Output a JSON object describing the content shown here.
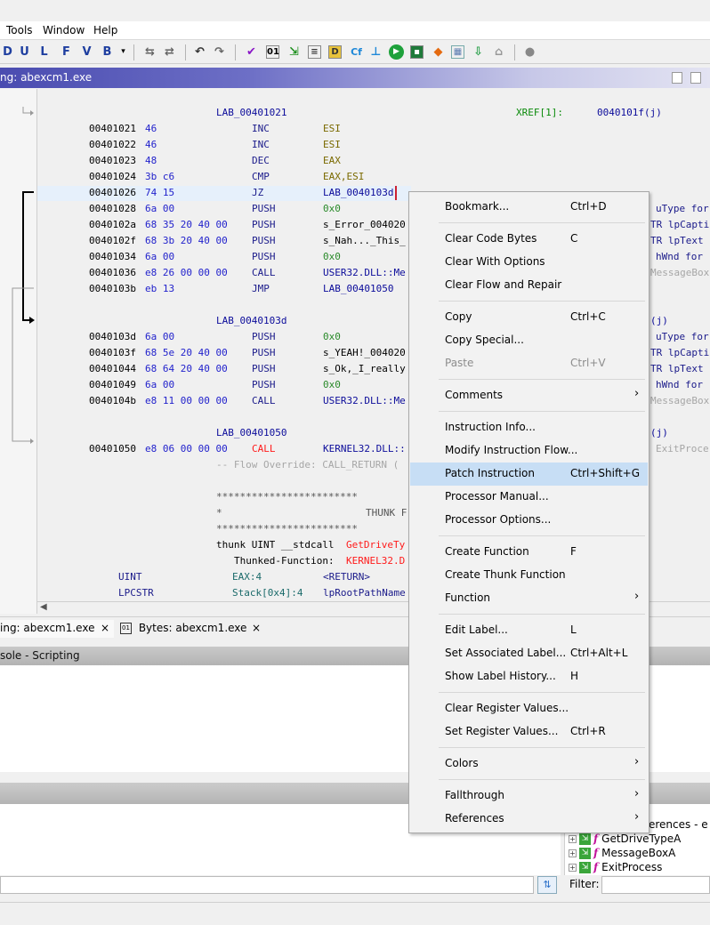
{
  "menubar": {
    "items": [
      "Tools",
      "Window",
      "Help"
    ]
  },
  "toolbar": {
    "letters": [
      "D",
      "U",
      "L",
      "F",
      "V",
      "B"
    ],
    "dropdown": "▾",
    "icons": [
      "undo-icon",
      "redo-icon",
      "checkmark-icon",
      "bytes-icon",
      "function-graph-icon",
      "data-icon",
      "cfg-icon",
      "tree-icon",
      "run-icon",
      "memory-icon",
      "diamond-icon",
      "table-icon",
      "export-icon",
      "network-icon",
      "help-icon"
    ]
  },
  "listing": {
    "title": "ng: abexcm1.exe",
    "lines": [
      {
        "label": "LAB_00401021",
        "xref": "XREF[1]:",
        "xref_target": "0040101f(j)"
      },
      {
        "addr": "00401021",
        "bytes": "46",
        "mnemonic": "INC",
        "operand": "ESI"
      },
      {
        "addr": "00401022",
        "bytes": "46",
        "mnemonic": "INC",
        "operand": "ESI"
      },
      {
        "addr": "00401023",
        "bytes": "48",
        "mnemonic": "DEC",
        "operand": "EAX"
      },
      {
        "addr": "00401024",
        "bytes": "3b c6",
        "mnemonic": "CMP",
        "operand": "EAX,ESI"
      },
      {
        "addr": "00401026",
        "bytes": "74 15",
        "mnemonic": "JZ",
        "operand": "LAB_0040103d",
        "right": "uType fo"
      },
      {
        "addr": "00401028",
        "bytes": "6a 00",
        "mnemonic": "PUSH",
        "operand": "0x0",
        "right": "uType for"
      },
      {
        "addr": "0040102a",
        "bytes": "68 35 20 40 00",
        "mnemonic": "PUSH",
        "operand": "s_Error_004020",
        "right": "TR lpCapti"
      },
      {
        "addr": "0040102f",
        "bytes": "68 3b 20 40 00",
        "mnemonic": "PUSH",
        "operand": "s_Nah..._This_",
        "right": "TR lpText"
      },
      {
        "addr": "00401034",
        "bytes": "6a 00",
        "mnemonic": "PUSH",
        "operand": "0x0",
        "right": "hWnd for"
      },
      {
        "addr": "00401036",
        "bytes": "e8 26 00 00 00",
        "mnemonic": "CALL",
        "operand": "USER32.DLL::Me",
        "right": "MessageBox"
      },
      {
        "addr": "0040103b",
        "bytes": "eb 13",
        "mnemonic": "JMP",
        "operand": "LAB_00401050"
      },
      {
        "label": "LAB_0040103d",
        "right": "(j)"
      },
      {
        "addr": "0040103d",
        "bytes": "6a 00",
        "mnemonic": "PUSH",
        "operand": "0x0",
        "right": "uType for"
      },
      {
        "addr": "0040103f",
        "bytes": "68 5e 20 40 00",
        "mnemonic": "PUSH",
        "operand": "s_YEAH!_004020",
        "right": "TR lpCapti"
      },
      {
        "addr": "00401044",
        "bytes": "68 64 20 40 00",
        "mnemonic": "PUSH",
        "operand": "s_Ok,_I_really",
        "right": "TR lpText"
      },
      {
        "addr": "00401049",
        "bytes": "6a 00",
        "mnemonic": "PUSH",
        "operand": "0x0",
        "right": "hWnd for"
      },
      {
        "addr": "0040104b",
        "bytes": "e8 11 00 00 00",
        "mnemonic": "CALL",
        "operand": "USER32.DLL::Me",
        "right": "MessageBox"
      },
      {
        "label": "LAB_00401050",
        "right": "(j)"
      },
      {
        "addr": "00401050",
        "bytes": "e8 06 00 00 00",
        "mnemonic": "CALL",
        "operand": "KERNEL32.DLL::",
        "right": "ExitProce"
      }
    ],
    "flow_override": "-- Flow Override: CALL_RETURN (",
    "stars1": "************************",
    "star_left": "*",
    "thunk_head": "THUNK F",
    "stars2": "************************",
    "thunk_sig_prefix": "thunk UINT __stdcall ",
    "thunk_sig_name": "GetDriveTy",
    "thunked_prefix": "Thunked-Function: ",
    "thunked_name": "KERNEL32.D",
    "param1_type": "UINT",
    "param1_loc": "EAX:4",
    "param1_name": "<RETURN>",
    "param2_type": "LPCSTR",
    "param2_loc": "Stack[0x4]:4",
    "param2_name": "lpRootPathName"
  },
  "tabs": [
    {
      "label": "ing: abexcm1.exe",
      "close": "×"
    },
    {
      "label": "Bytes: abexcm1.exe",
      "close": "×"
    }
  ],
  "console": {
    "title": "sole - Scripting"
  },
  "symbol_tree": {
    "header": "erences - e",
    "items": [
      "GetDriveTypeA",
      "MessageBoxA",
      "ExitProcess"
    ]
  },
  "filter": {
    "label": "Filter:"
  },
  "context_menu": {
    "items": [
      {
        "label": "Bookmark...",
        "shortcut": "Ctrl+D"
      },
      {
        "sep": true
      },
      {
        "label": "Clear Code Bytes",
        "shortcut": "C"
      },
      {
        "label": "Clear With Options",
        "shortcut": ""
      },
      {
        "label": "Clear Flow and Repair",
        "shortcut": ""
      },
      {
        "sep": true
      },
      {
        "label": "Copy",
        "shortcut": "Ctrl+C"
      },
      {
        "label": "Copy Special...",
        "shortcut": ""
      },
      {
        "label": "Paste",
        "shortcut": "Ctrl+V",
        "disabled": true
      },
      {
        "sep": true
      },
      {
        "label": "Comments",
        "shortcut": "",
        "submenu": true
      },
      {
        "sep": true
      },
      {
        "label": "Instruction Info...",
        "shortcut": ""
      },
      {
        "label": "Modify Instruction Flow...",
        "shortcut": ""
      },
      {
        "label": "Patch Instruction",
        "shortcut": "Ctrl+Shift+G",
        "selected": true
      },
      {
        "label": "Processor Manual...",
        "shortcut": ""
      },
      {
        "label": "Processor Options...",
        "shortcut": ""
      },
      {
        "sep": true
      },
      {
        "label": "Create Function",
        "shortcut": "F"
      },
      {
        "label": "Create Thunk Function",
        "shortcut": ""
      },
      {
        "label": "Function",
        "shortcut": "",
        "submenu": true
      },
      {
        "sep": true
      },
      {
        "label": "Edit Label...",
        "shortcut": "L"
      },
      {
        "label": "Set Associated Label...",
        "shortcut": "Ctrl+Alt+L"
      },
      {
        "label": "Show Label History...",
        "shortcut": "H"
      },
      {
        "sep": true
      },
      {
        "label": "Clear Register Values...",
        "shortcut": ""
      },
      {
        "label": "Set Register Values...",
        "shortcut": "Ctrl+R"
      },
      {
        "sep": true
      },
      {
        "label": "Colors",
        "shortcut": "",
        "submenu": true
      },
      {
        "sep": true
      },
      {
        "label": "Fallthrough",
        "shortcut": "",
        "submenu": true
      },
      {
        "label": "References",
        "shortcut": "",
        "submenu": true
      }
    ]
  }
}
